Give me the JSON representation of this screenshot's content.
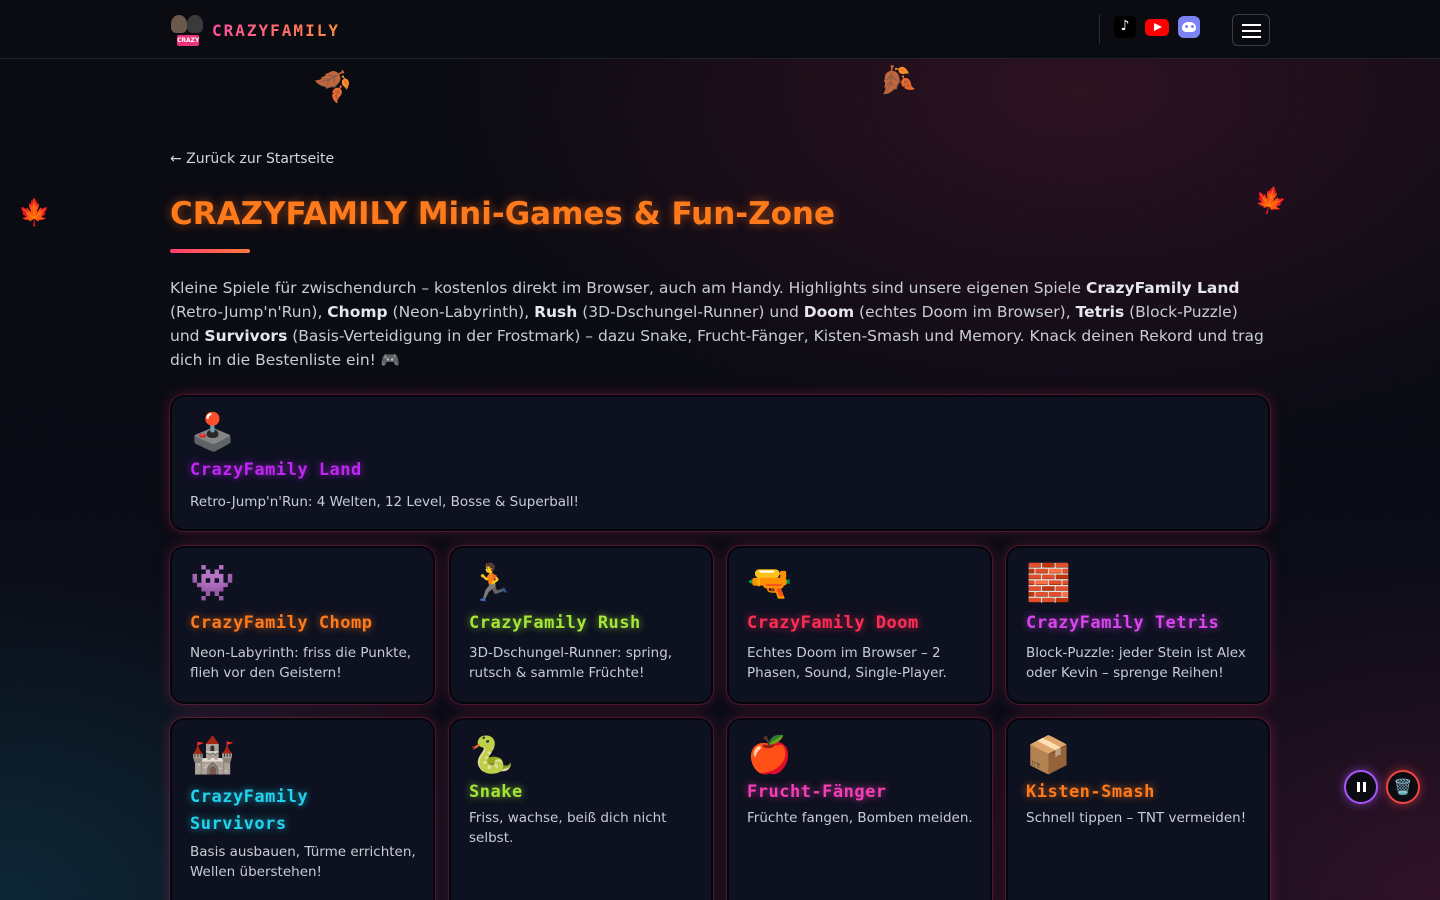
{
  "header": {
    "brand": "CRAZYFAMILY",
    "logo_tag": "CRAZY",
    "social": [
      {
        "name": "tiktok",
        "icon": "tiktok-icon"
      },
      {
        "name": "youtube",
        "icon": "youtube-icon"
      },
      {
        "name": "discord",
        "icon": "discord-icon"
      }
    ]
  },
  "back_link": "← Zurück zur Startseite",
  "page_title": "CRAZYFAMILY Mini-Games & Fun-Zone",
  "intro": {
    "t1": "Kleine Spiele für zwischendurch – kostenlos direkt im Browser, auch am Handy. Highlights sind unsere eigenen Spiele ",
    "b1": "CrazyFamily Land",
    "t2": " (Retro-Jump'n'Run), ",
    "b2": "Chomp",
    "t3": " (Neon-Labyrinth), ",
    "b3": "Rush",
    "t4": " (3D-Dschungel-Runner) und ",
    "b4": "Doom",
    "t5": " (echtes Doom im Browser), ",
    "b5": "Tetris",
    "t6": " (Block-Puzzle) und ",
    "b6": "Survivors",
    "t7": " (Basis-Verteidigung in der Frostmark) – dazu Snake, Frucht-Fänger, Kisten-Smash und Memory. Knack deinen Rekord und trag dich in die Bestenliste ein! 🎮"
  },
  "games": [
    {
      "icon": "🕹️",
      "title": "CrazyFamily Land",
      "desc": "Retro-Jump'n'Run: 4 Welten, 12 Level, Bosse & Superball!"
    },
    {
      "icon": "👾",
      "title": "CrazyFamily Chomp",
      "desc": "Neon-Labyrinth: friss die Punkte, flieh vor den Geistern!"
    },
    {
      "icon": "🏃",
      "title": "CrazyFamily Rush",
      "desc": "3D-Dschungel-Runner: spring, rutsch & sammle Früchte!"
    },
    {
      "icon": "🔫",
      "title": "CrazyFamily Doom",
      "desc": "Echtes Doom im Browser – 2 Phasen, Sound, Single-Player."
    },
    {
      "icon": "🧱",
      "title": "CrazyFamily Tetris",
      "desc": "Block-Puzzle: jeder Stein ist Alex oder Kevin – sprenge Reihen!"
    },
    {
      "icon": "🏰",
      "title": "CrazyFamily Survivors",
      "desc": "Basis ausbauen, Türme errichten, Wellen überstehen!"
    },
    {
      "icon": "🐍",
      "title": "Snake",
      "desc": "Friss, wachse, beiß dich nicht selbst."
    },
    {
      "icon": "🍎",
      "title": "Frucht-Fänger",
      "desc": "Früchte fangen, Bomben meiden."
    },
    {
      "icon": "📦",
      "title": "Kisten-Smash",
      "desc": "Schnell tippen – TNT vermeiden!"
    }
  ],
  "controls": {
    "pause_icon": "pause-icon",
    "trash_icon": "🗑️"
  }
}
